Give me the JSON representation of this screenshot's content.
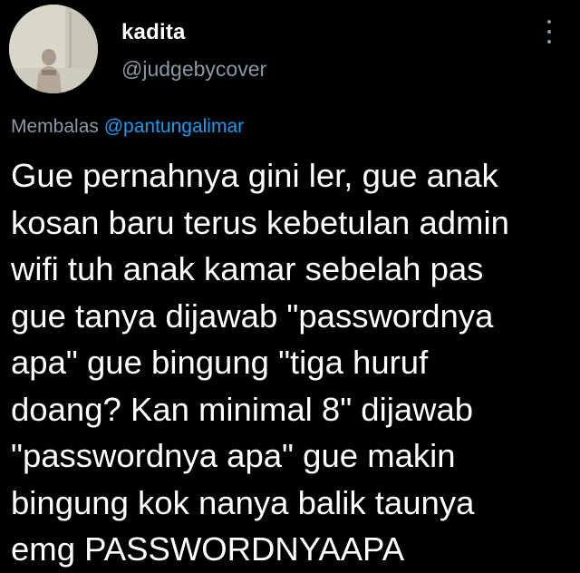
{
  "tweet": {
    "author": {
      "display_name": "kadita",
      "handle": "@judgebycover",
      "avatar_icon": "profile-photo"
    },
    "more_icon": "vertical-ellipsis-icon",
    "reply": {
      "prefix": "Membalas",
      "mention": "@pantungalimar"
    },
    "body_lines": [
      "Gue pernahnya gini ler, gue anak",
      "kosan baru terus kebetulan admin",
      "wifi tuh anak kamar sebelah pas",
      "gue tanya dijawab \"passwordnya",
      "apa\" gue bingung \"tiga huruf",
      "doang? Kan minimal 8\" dijawab",
      "\"passwordnya apa\" gue makin",
      "bingung kok nanya balik taunya",
      "emg PASSWORDNYAAPA"
    ]
  },
  "colors": {
    "background": "#000000",
    "text_primary": "#ffffff",
    "text_secondary": "#8b98a5",
    "link": "#1d9bf0"
  }
}
